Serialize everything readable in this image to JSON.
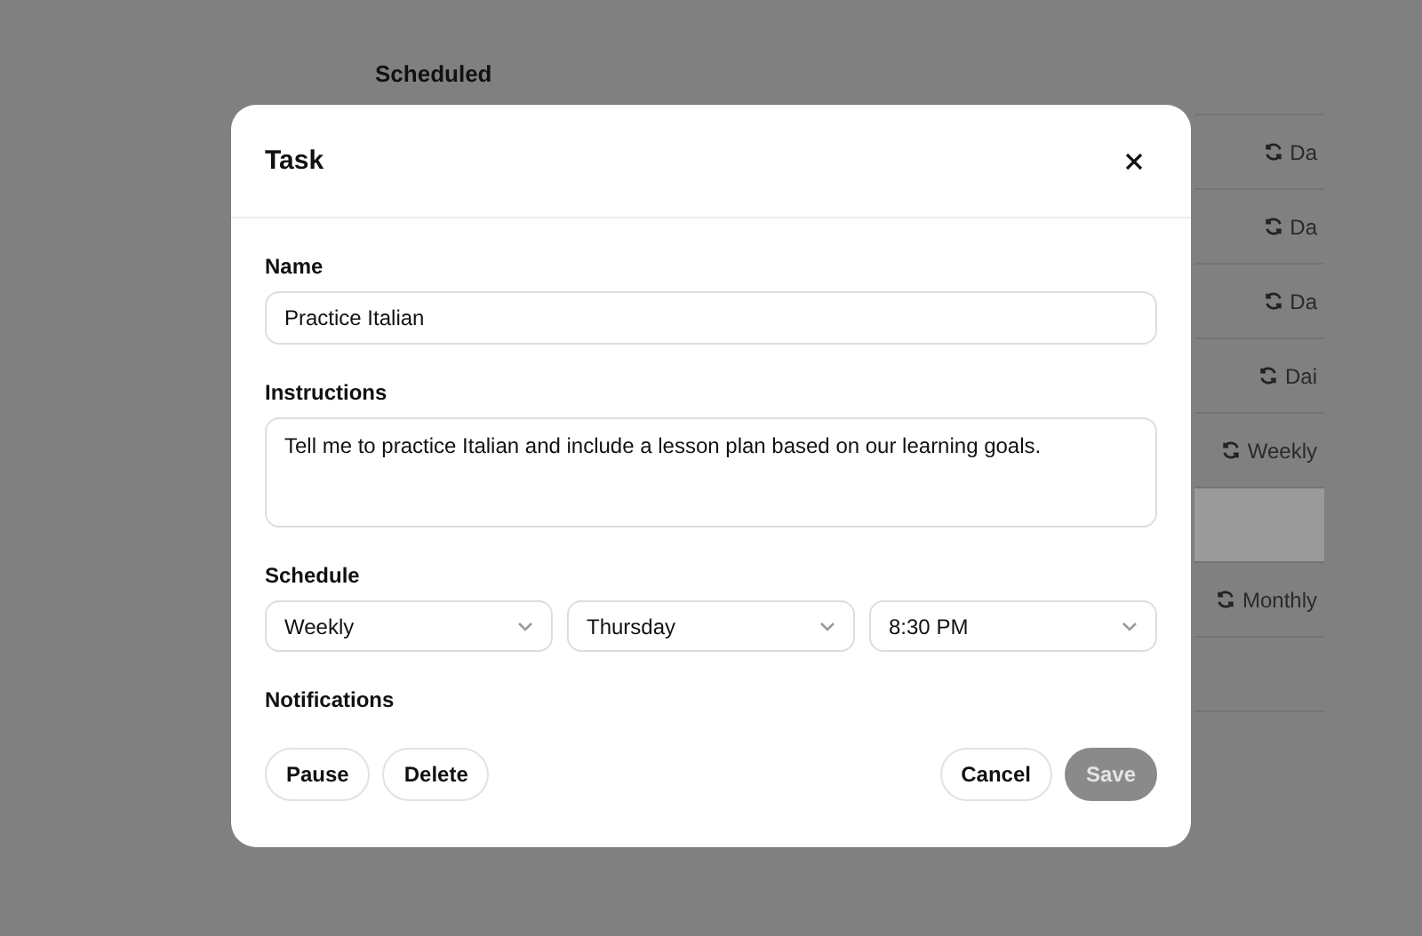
{
  "background": {
    "heading": "Scheduled",
    "rows": [
      {
        "label": "Da",
        "selected": false
      },
      {
        "label": "Da",
        "selected": false
      },
      {
        "label": "Da",
        "selected": false
      },
      {
        "label": "Dai",
        "selected": false
      },
      {
        "label": "Weekly",
        "selected": false
      },
      {
        "selected": true
      },
      {
        "label": "Monthly",
        "selected": false
      },
      {
        "selected": false
      }
    ]
  },
  "dialog": {
    "title": "Task",
    "fields": [
      {
        "kind": "text",
        "label": "Name",
        "value": "Practice Italian"
      },
      {
        "kind": "textarea",
        "label": "Instructions",
        "value": "Tell me to practice Italian and include a lesson plan based on our learning goals."
      },
      {
        "kind": "selects",
        "label": "Schedule",
        "options": [
          "Weekly",
          "Thursday",
          "8:30 PM"
        ]
      },
      {
        "kind": "heading",
        "label": "Notifications"
      }
    ],
    "footer": {
      "left": [
        {
          "label": "Pause",
          "kind": "secondary",
          "disabled": false
        },
        {
          "label": "Delete",
          "kind": "secondary",
          "disabled": false
        }
      ],
      "right": [
        {
          "label": "Cancel",
          "kind": "secondary",
          "disabled": false
        },
        {
          "label": "Save",
          "kind": "primary",
          "disabled": true
        }
      ]
    }
  }
}
